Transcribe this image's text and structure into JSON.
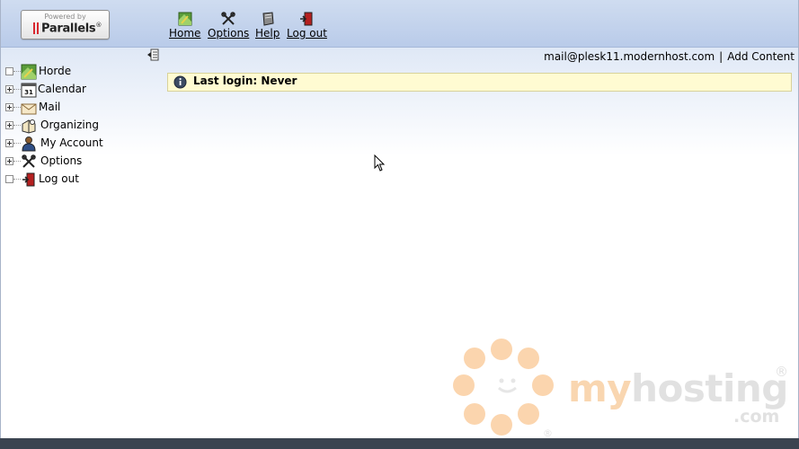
{
  "logo": {
    "powered_by": "Powered by",
    "brand": "Parallels",
    "mark": "®"
  },
  "nav": [
    {
      "label": "Home",
      "icon": "home-map-icon"
    },
    {
      "label": "Options",
      "icon": "options-tools-icon"
    },
    {
      "label": "Help",
      "icon": "help-book-icon"
    },
    {
      "label": "Log out",
      "icon": "logout-door-icon"
    }
  ],
  "userbar": {
    "email": "mail@plesk11.modernhost.com",
    "separator": "|",
    "add_content": "Add Content"
  },
  "notice": {
    "text": "Last login: Never",
    "icon": "info-icon"
  },
  "tree": [
    {
      "label": "Horde",
      "expandable": false,
      "icon": "horde-icon"
    },
    {
      "label": "Calendar",
      "expandable": true,
      "icon": "calendar-icon",
      "icon_text": "31"
    },
    {
      "label": "Mail",
      "expandable": true,
      "icon": "mail-envelope-icon"
    },
    {
      "label": "Organizing",
      "expandable": true,
      "icon": "organizing-icon"
    },
    {
      "label": "My Account",
      "expandable": true,
      "icon": "account-person-icon"
    },
    {
      "label": "Options",
      "expandable": true,
      "icon": "options-tools-icon"
    },
    {
      "label": "Log out",
      "expandable": false,
      "icon": "logout-door-icon"
    }
  ],
  "watermark": {
    "my": "my",
    "hosting": "hosting",
    "com": ".com",
    "registered": "®"
  },
  "colors": {
    "topbar": "#c3d3ee",
    "notice_bg": "#fffbd2",
    "watermark_orange": "#fbd5ae",
    "watermark_gray": "#e1e1e1"
  }
}
